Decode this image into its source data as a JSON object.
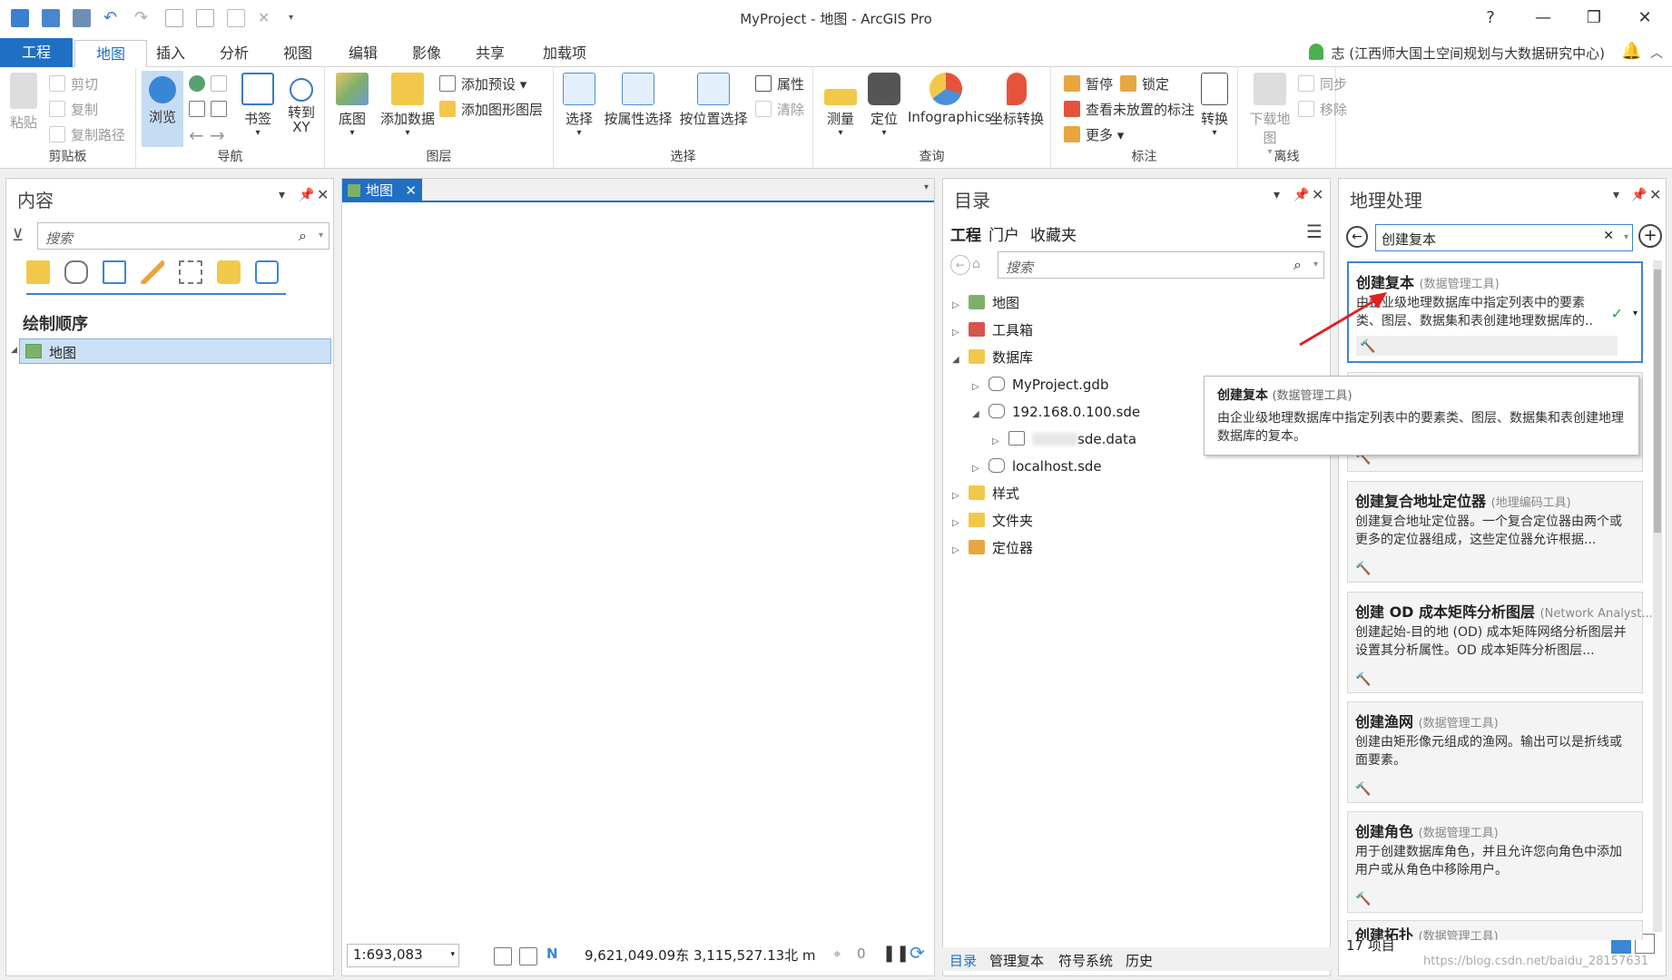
{
  "window": {
    "title": "MyProject - 地图 - ArcGIS Pro",
    "help": "?",
    "minimize": "—",
    "restore": "❐",
    "close": "✕"
  },
  "ribbon_tabs": [
    "工程",
    "地图",
    "插入",
    "分析",
    "视图",
    "编辑",
    "影像",
    "共享",
    "加载项"
  ],
  "user": "志 (江西师大国土空间规划与大数据研究中心)",
  "clipboard": {
    "paste": "粘贴",
    "cut": "剪切",
    "copy": "复制",
    "copy_path": "复制路径",
    "label": "剪贴板"
  },
  "navigate": {
    "explore": "浏览",
    "bookmarks": "书签",
    "goto_xy": "转到\nXY",
    "label": "导航"
  },
  "layer": {
    "basemap": "底图",
    "add_data": "添加数据",
    "add_preset": "添加预设",
    "add_graphics": "添加图形图层",
    "label": "图层"
  },
  "selection": {
    "select": "选择",
    "by_attr": "按属性选择",
    "by_location": "按位置选择",
    "attributes": "属性",
    "clear": "清除",
    "label": "选择"
  },
  "inquiry": {
    "measure": "测量",
    "locate": "定位",
    "infographics": "Infographics",
    "coord_conv": "坐标转换",
    "label": "查询"
  },
  "labeling": {
    "pause": "暂停",
    "lock": "锁定",
    "view_unplaced": "查看未放置的标注",
    "more": "更多",
    "convert": "转换",
    "label": "标注"
  },
  "offline": {
    "download_map": "下载地图",
    "sync": "同步",
    "remove": "移除",
    "label": "离线"
  },
  "contents": {
    "title": "内容",
    "search_placeholder": "搜索",
    "draw_order": "绘制顺序",
    "map_item": "地图"
  },
  "map_tab": {
    "label": "地图"
  },
  "status": {
    "scale": "1:693,083",
    "coords": "9,621,049.09东 3,115,527.13北 m",
    "selected": "0"
  },
  "catalog": {
    "title": "目录",
    "tabs": [
      "工程",
      "门户",
      "收藏夹"
    ],
    "search_placeholder": "搜索",
    "tree": [
      "地图",
      "工具箱",
      "数据库",
      "MyProject.gdb",
      "192.168.0.100.sde",
      "sde.data",
      "localhost.sde",
      "样式",
      "文件夹",
      "定位器"
    ],
    "bottom_tabs": [
      "目录",
      "管理复本",
      "符号系统",
      "历史"
    ]
  },
  "geoprocessing": {
    "title": "地理处理",
    "search_value": "创建复本",
    "tools": [
      {
        "name": "创建复本",
        "category": "(数据管理工具)",
        "desc": "由企业级地理数据库中指定列表中的要素类、图层、数据集和表创建地理数据库的.."
      },
      {
        "name": "创建复合地址定位器",
        "category": "(地理编码工具)",
        "desc": "创建复合地址定位器。一个复合定位器由两个或更多的定位器组成，这些定位器允许根据..."
      },
      {
        "name": "创建 OD 成本矩阵分析图层",
        "category": "(Network Analyst...",
        "desc": "创建起始-目的地 (OD) 成本矩阵网络分析图层并设置其分析属性。OD 成本矩阵分析图层..."
      },
      {
        "name": "创建渔网",
        "category": "(数据管理工具)",
        "desc": "创建由矩形像元组成的渔网。输出可以是折线或面要素。"
      },
      {
        "name": "创建角色",
        "category": "(数据管理工具)",
        "desc": "用于创建数据库角色，并且允许您向角色中添加用户或从角色中移除用户。"
      },
      {
        "name": "创建拓扑",
        "category": "(数据管理工具)",
        "desc": ""
      }
    ],
    "count": "17 项目"
  },
  "tooltip": {
    "name": "创建复本",
    "category": "(数据管理工具)",
    "desc": "由企业级地理数据库中指定列表中的要素类、图层、数据集和表创建地理数据库的复本。"
  },
  "watermark": "https://blog.csdn.net/baidu_28157631"
}
